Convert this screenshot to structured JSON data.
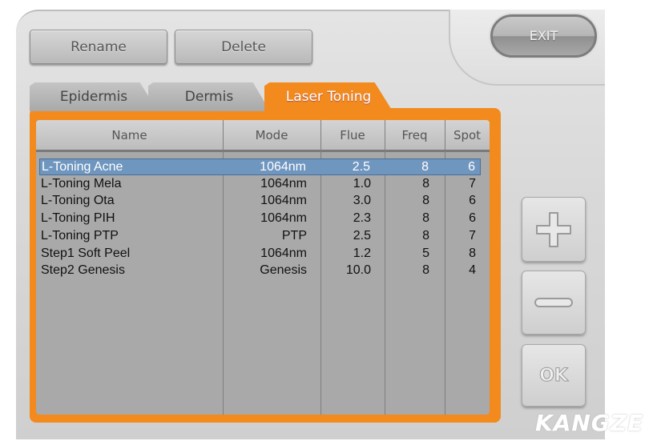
{
  "toolbar": {
    "rename": "Rename",
    "delete": "Delete",
    "exit": "EXIT"
  },
  "tabs": [
    {
      "label": "Epidermis",
      "active": false
    },
    {
      "label": "Dermis",
      "active": false
    },
    {
      "label": "Laser Toning",
      "active": true
    }
  ],
  "table": {
    "columns": [
      "Name",
      "Mode",
      "Flue",
      "Freq",
      "Spot"
    ],
    "rows": [
      {
        "name": "L-Toning Acne",
        "mode": "1064nm",
        "flue": "2.5",
        "freq": "8",
        "spot": "6",
        "selected": true
      },
      {
        "name": "L-Toning Mela",
        "mode": "1064nm",
        "flue": "1.0",
        "freq": "8",
        "spot": "7"
      },
      {
        "name": "L-Toning Ota",
        "mode": "1064nm",
        "flue": "3.0",
        "freq": "8",
        "spot": "6"
      },
      {
        "name": "L-Toning PIH",
        "mode": "1064nm",
        "flue": "2.3",
        "freq": "8",
        "spot": "6"
      },
      {
        "name": "L-Toning PTP",
        "mode": "PTP",
        "flue": "2.5",
        "freq": "8",
        "spot": "7"
      },
      {
        "name": "Step1 Soft Peel",
        "mode": "1064nm",
        "flue": "1.2",
        "freq": "5",
        "spot": "8"
      },
      {
        "name": "Step2 Genesis",
        "mode": "Genesis",
        "flue": "10.0",
        "freq": "8",
        "spot": "4"
      }
    ]
  },
  "side": {
    "plus_icon": "plus-icon",
    "minus_icon": "minus-icon",
    "ok": "OK"
  },
  "brand": {
    "logo": "KANGZE"
  },
  "colors": {
    "accent": "#f28a1e",
    "selection": "#6f96bf"
  }
}
